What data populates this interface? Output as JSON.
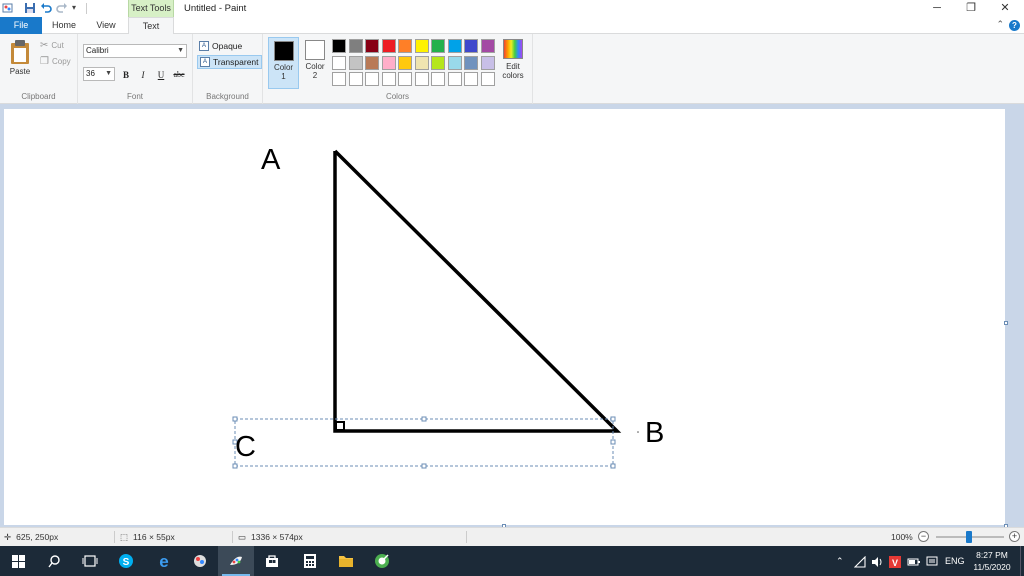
{
  "window": {
    "tool_tab": "Text Tools",
    "title": "Untitled - Paint"
  },
  "tabs": {
    "file": "File",
    "home": "Home",
    "view": "View",
    "text": "Text"
  },
  "clipboard": {
    "paste": "Paste",
    "cut": "Cut",
    "copy": "Copy",
    "group_label": "Clipboard"
  },
  "font": {
    "family": "Calibri",
    "size": "36",
    "bold": "B",
    "italic": "I",
    "underline": "U",
    "strike": "abc",
    "group_label": "Font"
  },
  "background": {
    "opaque": "Opaque",
    "transparent": "Transparent",
    "group_label": "Background"
  },
  "colors": {
    "color1_label": "Color",
    "color1_num": "1",
    "color2_label": "Color",
    "color2_num": "2",
    "color1": "#000000",
    "color2": "#ffffff",
    "edit_label_1": "Edit",
    "edit_label_2": "colors",
    "group_label": "Colors",
    "palette_row1": [
      "#000000",
      "#7f7f7f",
      "#880015",
      "#ed1c24",
      "#ff7f27",
      "#fff200",
      "#22b14c",
      "#00a2e8",
      "#3f48cc",
      "#a349a4"
    ],
    "palette_row2": [
      "#ffffff",
      "#c3c3c3",
      "#b97a57",
      "#ffaec9",
      "#ffc90e",
      "#efe4b0",
      "#b5e61d",
      "#99d9ea",
      "#7092be",
      "#c8bfe7"
    ],
    "palette_row3": [
      "#ffffff",
      "#ffffff",
      "#ffffff",
      "#ffffff",
      "#ffffff",
      "#ffffff",
      "#ffffff",
      "#ffffff",
      "#ffffff",
      "#ffffff"
    ]
  },
  "drawing": {
    "label_a": "A",
    "label_b": "B",
    "label_c": "C"
  },
  "status": {
    "cursor_pos": "625, 250px",
    "selection_size": "116 × 55px",
    "image_size": "1336 × 574px",
    "zoom": "100%"
  },
  "taskbar": {
    "language": "ENG",
    "time": "8:27 PM",
    "date": "11/5/2020"
  }
}
